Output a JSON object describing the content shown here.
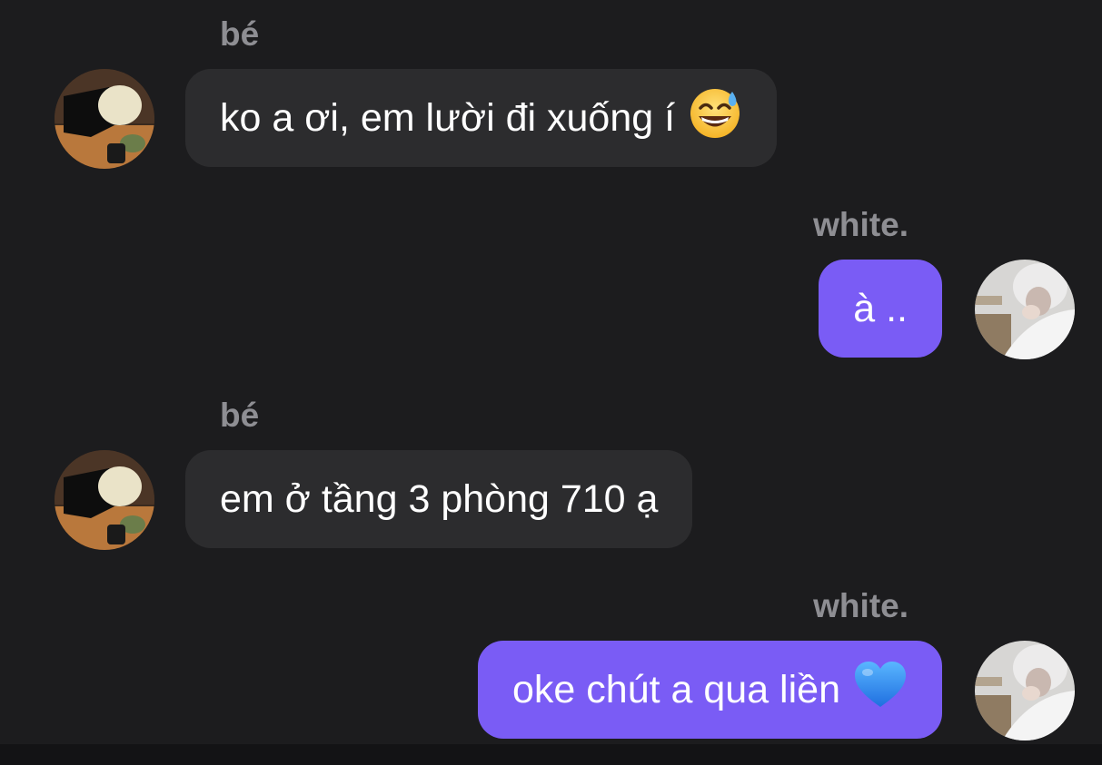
{
  "messages": [
    {
      "sender": "bé",
      "side": "incoming",
      "text": "ko a ơi, em lười đi xuống í",
      "emoji": "grinning-face-with-sweat-icon"
    },
    {
      "sender": "white.",
      "side": "outgoing",
      "text": "à ..",
      "emoji": ""
    },
    {
      "sender": "bé",
      "side": "incoming",
      "text": "em ở tầng 3 phòng 710 ạ",
      "emoji": ""
    },
    {
      "sender": "white.",
      "side": "outgoing",
      "text": "oke chút a qua liền",
      "emoji": "blue-heart-icon"
    }
  ],
  "colors": {
    "background": "#1c1c1e",
    "incoming_bubble": "#2c2c2e",
    "outgoing_bubble": "#7a5cf5",
    "sender_name": "#8e8e93",
    "message_text": "#ffffff"
  }
}
